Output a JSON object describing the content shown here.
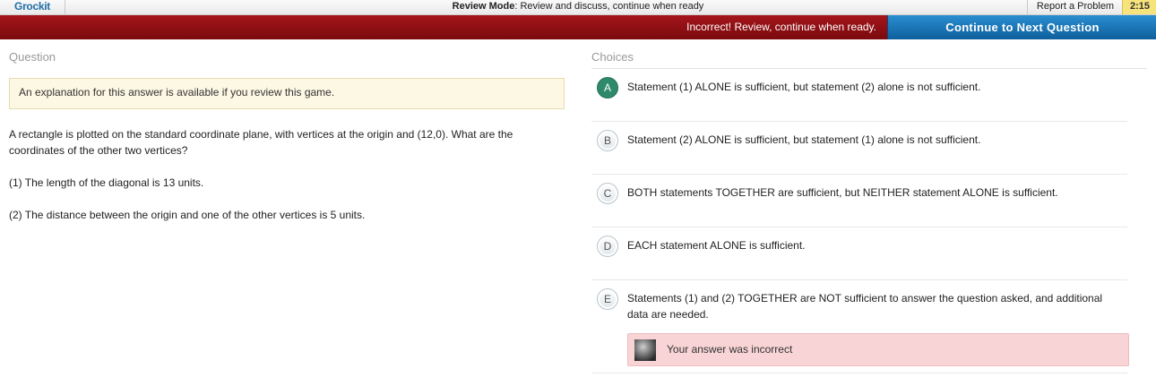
{
  "topbar": {
    "logo": "Grockit",
    "mode_label": "Review Mode",
    "mode_text": ": Review and discuss, continue when ready",
    "report_label": "Report a Problem",
    "timer": "2:15"
  },
  "status": {
    "message": "Incorrect! Review, continue when ready.",
    "continue_label": "Continue to Next Question"
  },
  "question": {
    "heading": "Question",
    "explanation_note": "An explanation for this answer is available if you review this game.",
    "stem": "A rectangle is plotted on the standard coordinate plane, with vertices at the origin and (12,0). What are the coordinates of the other two vertices?",
    "statement1": "(1) The length of the diagonal is 13 units.",
    "statement2": "(2) The distance between the origin and one of the other vertices is 5 units."
  },
  "choices": {
    "heading": "Choices",
    "items": [
      {
        "letter": "A",
        "text": "Statement (1) ALONE is sufficient, but statement (2) alone is not sufficient."
      },
      {
        "letter": "B",
        "text": "Statement (2) ALONE is sufficient, but statement (1) alone is not sufficient."
      },
      {
        "letter": "C",
        "text": "BOTH statements TOGETHER are sufficient, but NEITHER statement ALONE is sufficient."
      },
      {
        "letter": "D",
        "text": "EACH statement ALONE is sufficient."
      },
      {
        "letter": "E",
        "text": "Statements (1) and (2) TOGETHER are NOT sufficient to answer the question asked, and additional data are needed."
      }
    ],
    "feedback": "Your answer was incorrect"
  }
}
